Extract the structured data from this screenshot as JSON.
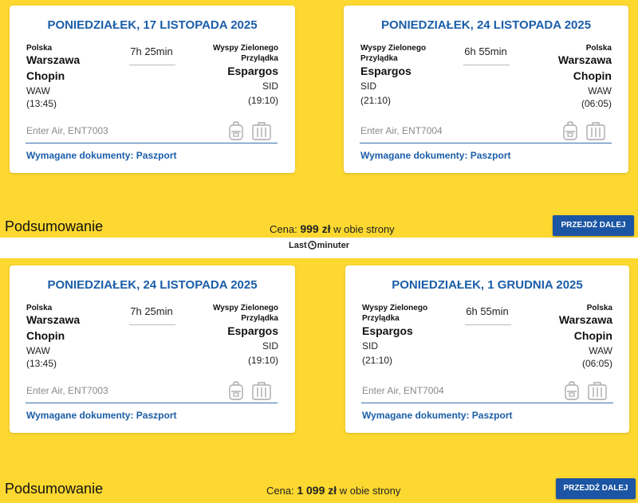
{
  "brand": {
    "part1": "Last",
    "part2": "minuter"
  },
  "offers": [
    {
      "outbound": {
        "date": "PONIEDZIAŁEK, 17 LISTOPADA 2025",
        "from": {
          "country": "Polska",
          "city1": "Warszawa",
          "city2": "Chopin",
          "code": "WAW",
          "time": "(13:45)"
        },
        "to": {
          "country1": "Wyspy Zielonego",
          "country2": "Przylądka",
          "city1": "Espargos",
          "city2": "",
          "code": "SID",
          "time": "(19:10)"
        },
        "duration": "7h 25min",
        "airline": "Enter Air, ENT7003",
        "docs": "Wymagane dokumenty: Paszport"
      },
      "inbound": {
        "date": "PONIEDZIAŁEK, 24 LISTOPADA 2025",
        "from": {
          "country1": "Wyspy Zielonego",
          "country2": "Przylądka",
          "city1": "Espargos",
          "city2": "",
          "code": "SID",
          "time": "(21:10)"
        },
        "to": {
          "country": "Polska",
          "city1": "Warszawa",
          "city2": "Chopin",
          "code": "WAW",
          "time": "(06:05)"
        },
        "duration": "6h 55min",
        "airline": "Enter Air, ENT7004",
        "docs": "Wymagane dokumenty: Paszport"
      },
      "summary": "Podsumowanie",
      "price_prefix": "Cena:",
      "price_value": "999 zł",
      "price_suffix": "w obie strony",
      "button": "PRZEJDŹ DALEJ"
    },
    {
      "outbound": {
        "date": "PONIEDZIAŁEK, 24 LISTOPADA 2025",
        "from": {
          "country": "Polska",
          "city1": "Warszawa",
          "city2": "Chopin",
          "code": "WAW",
          "time": "(13:45)"
        },
        "to": {
          "country1": "Wyspy Zielonego",
          "country2": "Przylądka",
          "city1": "Espargos",
          "city2": "",
          "code": "SID",
          "time": "(19:10)"
        },
        "duration": "7h 25min",
        "airline": "Enter Air, ENT7003",
        "docs": "Wymagane dokumenty: Paszport"
      },
      "inbound": {
        "date": "PONIEDZIAŁEK, 1 GRUDNIA 2025",
        "from": {
          "country1": "Wyspy Zielonego",
          "country2": "Przylądka",
          "city1": "Espargos",
          "city2": "",
          "code": "SID",
          "time": "(21:10)"
        },
        "to": {
          "country": "Polska",
          "city1": "Warszawa",
          "city2": "Chopin",
          "code": "WAW",
          "time": "(06:05)"
        },
        "duration": "6h 55min",
        "airline": "Enter Air, ENT7004",
        "docs": "Wymagane dokumenty: Paszport"
      },
      "summary": "Podsumowanie",
      "price_prefix": "Cena:",
      "price_value": "1 099 zł",
      "price_suffix": "w obie strony",
      "button": "PRZEJDŹ DALEJ"
    }
  ],
  "icons": {
    "cabin_bag": "backpack-icon",
    "checked_bag": "suitcase-icon",
    "logo": "clock-logo-icon"
  },
  "colors": {
    "panel": "#fcd830",
    "accent": "#1b5ea8",
    "button": "#1b55a3"
  }
}
